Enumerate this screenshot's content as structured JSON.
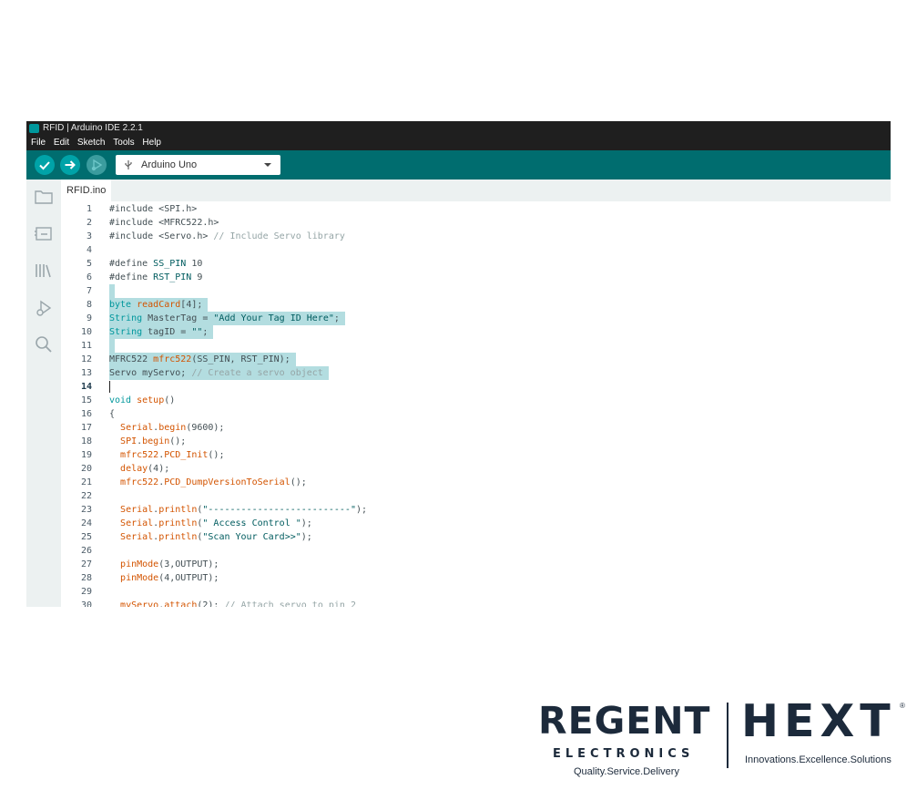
{
  "window": {
    "title": "RFID | Arduino IDE 2.2.1"
  },
  "menu": [
    "File",
    "Edit",
    "Sketch",
    "Tools",
    "Help"
  ],
  "toolbar": {
    "board": "Arduino Uno",
    "colors": {
      "bar": "#006d6f",
      "button": "#00a3a8",
      "disabled": "#3b9c9e"
    }
  },
  "sidebar_icons": [
    "folder-icon",
    "board-manager-icon",
    "library-icon",
    "debug-icon",
    "search-icon"
  ],
  "tab": {
    "label": "RFID.ino"
  },
  "editor": {
    "active_line": 14,
    "lines": [
      {
        "n": "1",
        "tokens": [
          [
            "t",
            "#include <SPI.h>"
          ]
        ]
      },
      {
        "n": "2",
        "tokens": [
          [
            "t",
            "#include <MFRC522.h>"
          ]
        ]
      },
      {
        "n": "3",
        "tokens": [
          [
            "t",
            "#include <Servo.h> "
          ],
          [
            "cm",
            "// Include Servo library"
          ]
        ]
      },
      {
        "n": "4",
        "tokens": []
      },
      {
        "n": "5",
        "tokens": [
          [
            "t",
            "#define "
          ],
          [
            "st",
            "SS_PIN"
          ],
          [
            "t",
            " 10"
          ]
        ]
      },
      {
        "n": "6",
        "tokens": [
          [
            "t",
            "#define "
          ],
          [
            "st",
            "RST_PIN"
          ],
          [
            "t",
            " 9"
          ]
        ]
      },
      {
        "n": "7",
        "tokens": []
      },
      {
        "n": "8",
        "tokens": [
          [
            "kw",
            "byte"
          ],
          [
            "t",
            " "
          ],
          [
            "fn",
            "readCard"
          ],
          [
            "t",
            "[4];"
          ]
        ]
      },
      {
        "n": "9",
        "tokens": [
          [
            "kw",
            "String"
          ],
          [
            "t",
            " MasterTag = "
          ],
          [
            "st",
            "\"Add Your Tag ID Here\""
          ],
          [
            "t",
            ";"
          ]
        ]
      },
      {
        "n": "10",
        "tokens": [
          [
            "kw",
            "String"
          ],
          [
            "t",
            " tagID = "
          ],
          [
            "st",
            "\"\""
          ],
          [
            "t",
            ";"
          ]
        ]
      },
      {
        "n": "11",
        "tokens": []
      },
      {
        "n": "12",
        "tokens": [
          [
            "t",
            "MFRC522 "
          ],
          [
            "fn",
            "mfrc522"
          ],
          [
            "t",
            "(SS_PIN, RST_PIN);"
          ]
        ]
      },
      {
        "n": "13",
        "tokens": [
          [
            "t",
            "Servo myServo; "
          ],
          [
            "cm",
            "// Create a servo object"
          ]
        ]
      },
      {
        "n": "14",
        "tokens": []
      },
      {
        "n": "15",
        "tokens": [
          [
            "kw",
            "void"
          ],
          [
            "t",
            " "
          ],
          [
            "fn",
            "setup"
          ],
          [
            "t",
            "()"
          ]
        ]
      },
      {
        "n": "16",
        "tokens": [
          [
            "t",
            "{"
          ]
        ]
      },
      {
        "n": "17",
        "tokens": [
          [
            "t",
            "  "
          ],
          [
            "fn",
            "Serial"
          ],
          [
            "t",
            "."
          ],
          [
            "fn",
            "begin"
          ],
          [
            "t",
            "(9600);"
          ]
        ]
      },
      {
        "n": "18",
        "tokens": [
          [
            "t",
            "  "
          ],
          [
            "fn",
            "SPI"
          ],
          [
            "t",
            "."
          ],
          [
            "fn",
            "begin"
          ],
          [
            "t",
            "();"
          ]
        ]
      },
      {
        "n": "19",
        "tokens": [
          [
            "t",
            "  "
          ],
          [
            "fn",
            "mfrc522"
          ],
          [
            "t",
            "."
          ],
          [
            "fn",
            "PCD_Init"
          ],
          [
            "t",
            "();"
          ]
        ]
      },
      {
        "n": "20",
        "tokens": [
          [
            "t",
            "  "
          ],
          [
            "fn",
            "delay"
          ],
          [
            "t",
            "(4);"
          ]
        ]
      },
      {
        "n": "21",
        "tokens": [
          [
            "t",
            "  "
          ],
          [
            "fn",
            "mfrc522"
          ],
          [
            "t",
            "."
          ],
          [
            "fn",
            "PCD_DumpVersionToSerial"
          ],
          [
            "t",
            "();"
          ]
        ]
      },
      {
        "n": "22",
        "tokens": []
      },
      {
        "n": "23",
        "tokens": [
          [
            "t",
            "  "
          ],
          [
            "fn",
            "Serial"
          ],
          [
            "t",
            "."
          ],
          [
            "fn",
            "println"
          ],
          [
            "t",
            "("
          ],
          [
            "st",
            "\"--------------------------\""
          ],
          [
            "t",
            ");"
          ]
        ]
      },
      {
        "n": "24",
        "tokens": [
          [
            "t",
            "  "
          ],
          [
            "fn",
            "Serial"
          ],
          [
            "t",
            "."
          ],
          [
            "fn",
            "println"
          ],
          [
            "t",
            "("
          ],
          [
            "st",
            "\" Access Control \""
          ],
          [
            "t",
            ");"
          ]
        ]
      },
      {
        "n": "25",
        "tokens": [
          [
            "t",
            "  "
          ],
          [
            "fn",
            "Serial"
          ],
          [
            "t",
            "."
          ],
          [
            "fn",
            "println"
          ],
          [
            "t",
            "("
          ],
          [
            "st",
            "\"Scan Your Card>>\""
          ],
          [
            "t",
            ");"
          ]
        ]
      },
      {
        "n": "26",
        "tokens": []
      },
      {
        "n": "27",
        "tokens": [
          [
            "t",
            "  "
          ],
          [
            "fn",
            "pinMode"
          ],
          [
            "t",
            "(3,OUTPUT);"
          ]
        ]
      },
      {
        "n": "28",
        "tokens": [
          [
            "t",
            "  "
          ],
          [
            "fn",
            "pinMode"
          ],
          [
            "t",
            "(4,OUTPUT);"
          ]
        ]
      },
      {
        "n": "29",
        "tokens": []
      },
      {
        "n": "30",
        "tokens": [
          [
            "t",
            "  "
          ],
          [
            "fn",
            "myServo"
          ],
          [
            "t",
            "."
          ],
          [
            "fn",
            "attach"
          ],
          [
            "t",
            "(2); "
          ],
          [
            "cm",
            "// Attach servo to pin 2"
          ]
        ]
      }
    ],
    "selection": [
      {
        "line": 7,
        "chars": 1
      },
      {
        "line": 8,
        "chars": 18
      },
      {
        "line": 9,
        "chars": 43
      },
      {
        "line": 10,
        "chars": 19
      },
      {
        "line": 11,
        "chars": 1
      },
      {
        "line": 12,
        "chars": 34
      },
      {
        "line": 13,
        "chars": 40
      }
    ]
  },
  "logos": {
    "regent": {
      "name": "REGENT",
      "sub": "ELECTRONICS",
      "tagline": "Quality.Service.Delivery"
    },
    "hext": {
      "name": "HEXT",
      "mark": "®",
      "tagline": "Innovations.Excellence.Solutions"
    }
  }
}
